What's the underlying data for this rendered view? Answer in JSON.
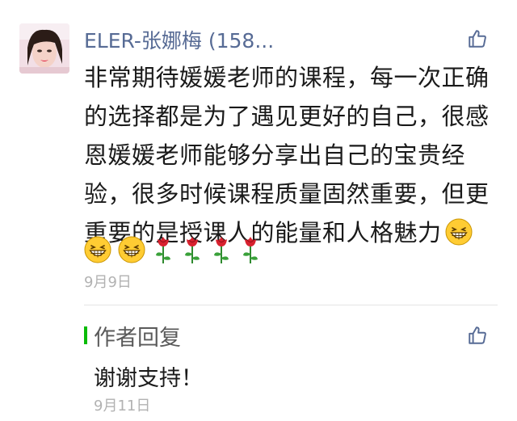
{
  "comment": {
    "username": "ELER-张娜梅 (158...",
    "text": "非常期待媛媛老师的课程，每一次正确的选择都是为了遇见更好的自己，很感恩媛媛老师能够分享出自己的宝贵经验，很多时候课程质量固然重要，但更重要的是授课人的能量和人格魅力",
    "date": "9月9日",
    "trailing_emoji": "grin-emoji",
    "emojis": [
      "grin-emoji",
      "grin-emoji",
      "rose-emoji",
      "rose-emoji",
      "rose-emoji",
      "rose-emoji"
    ]
  },
  "reply": {
    "title": "作者回复",
    "text": "谢谢支持！",
    "date": "9月11日"
  },
  "colors": {
    "username": "#576b95",
    "reply_bar": "#09bb07",
    "date": "#b2b2b2",
    "like_icon": "#576b95"
  },
  "icons": {
    "like": "thumbs-up-icon"
  }
}
